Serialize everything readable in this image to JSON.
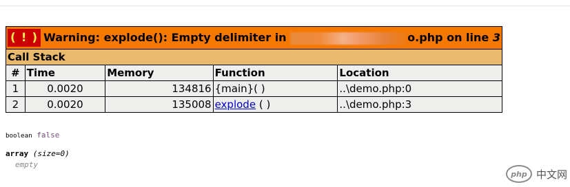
{
  "warning": {
    "icon_text": "( ! )",
    "message_prefix": "Warning: explode(): Empty delimiter in",
    "message_suffix": "o.php on line",
    "line_number": "3"
  },
  "call_stack": {
    "title": "Call Stack",
    "headers": [
      "#",
      "Time",
      "Memory",
      "Function",
      "Location"
    ],
    "rows": [
      {
        "num": "1",
        "time": "0.0020",
        "memory": "134816",
        "function": "{main}( )",
        "function_link": "",
        "function_args": "",
        "location": "..\\demo.php:0"
      },
      {
        "num": "2",
        "time": "0.0020",
        "memory": "135008",
        "function": "",
        "function_link": "explode",
        "function_args": " ( )",
        "location": "..\\demo.php:3"
      }
    ]
  },
  "var_dump": {
    "line1_type": "boolean",
    "line1_value": "false",
    "line2_type": "array",
    "line2_size": "(size=0)",
    "line3": "empty"
  },
  "watermark": {
    "logo": "php",
    "text": "中文网"
  },
  "colors": {
    "warning_bg": "#f57900",
    "icon_bg": "#cc0000",
    "callstack_bg": "#e9b96e",
    "row_bg": "#eeeeec",
    "link": "#0000cc",
    "value_purple": "#75507b"
  }
}
